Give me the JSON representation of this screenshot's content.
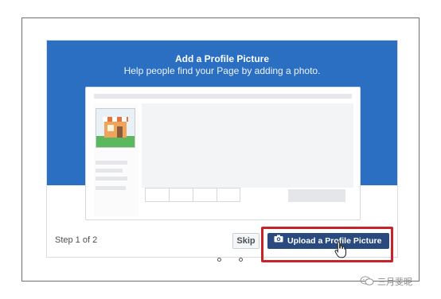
{
  "dialog": {
    "title": "Add a Profile Picture",
    "subtitle": "Help people find your Page by adding a photo.",
    "step_label": "Step 1 of 2",
    "skip_label": "Skip",
    "upload_label": "Upload a Profile Picture"
  },
  "colors": {
    "banner": "#2b6fc3",
    "upload_button": "#2a4a7f",
    "highlight": "#c8222a"
  },
  "icons": [
    "camera-icon",
    "hand-pointer-icon",
    "storefront-icon",
    "wechat-icon"
  ],
  "pagination": {
    "dots": 2
  },
  "watermark": "三月斐昵"
}
